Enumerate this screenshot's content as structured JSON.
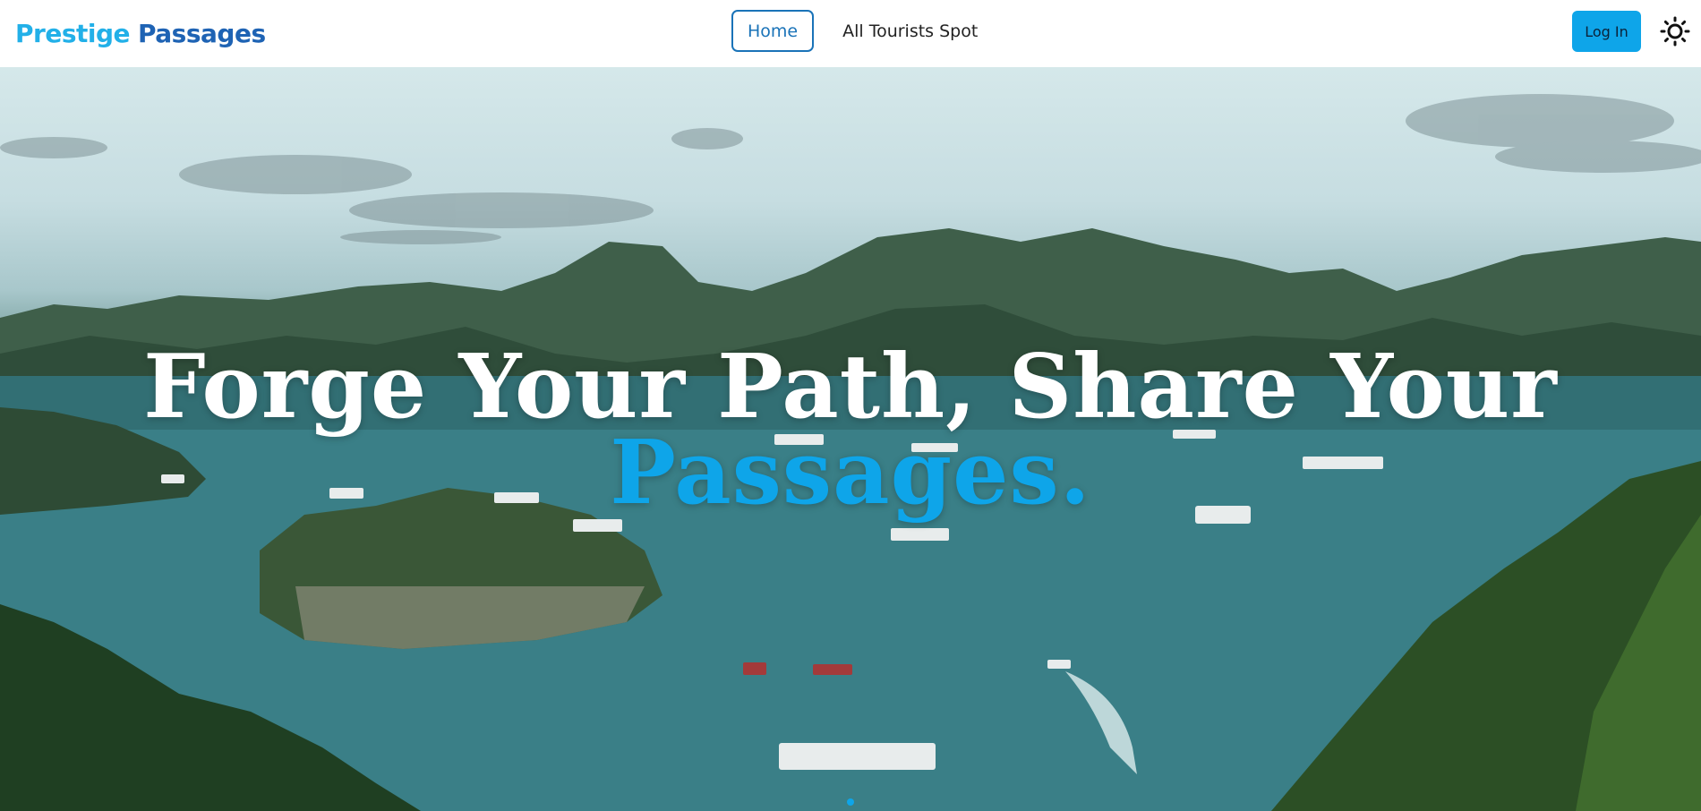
{
  "brand": {
    "part1": "Prestige",
    "part2": "Passages"
  },
  "nav": {
    "links": [
      {
        "label": "Home",
        "active": true
      },
      {
        "label": "All Tourists Spot",
        "active": false
      }
    ],
    "login_label": "Log In",
    "theme_icon": "sun-icon"
  },
  "hero": {
    "line1": "Forge Your Path, Share Your",
    "line2": "Passages.",
    "accent_color": "#0ea5e9",
    "slide_count": 1,
    "active_slide": 1
  },
  "colors": {
    "brand_light": "#22b0e8",
    "brand_dark": "#1e63b4",
    "primary": "#0ea5e9"
  }
}
